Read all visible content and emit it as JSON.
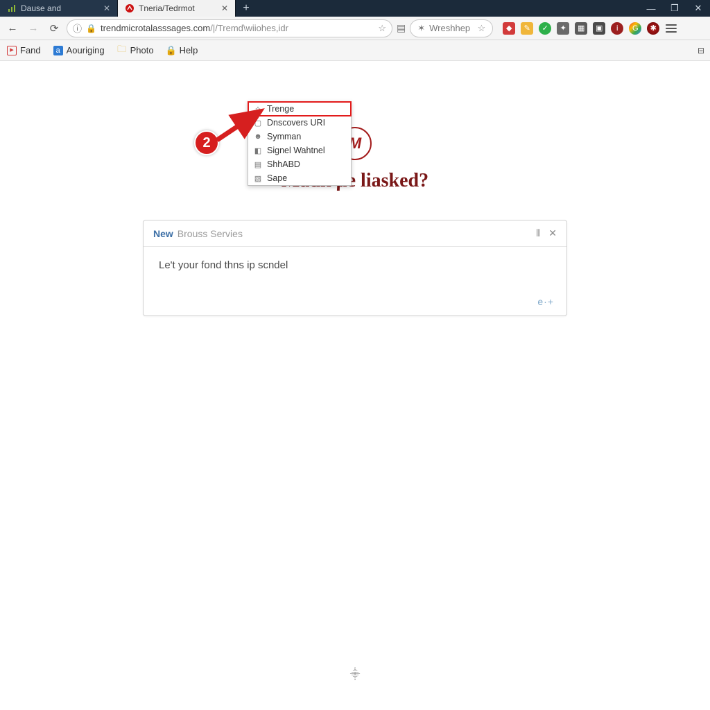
{
  "titlebar": {
    "tabs": [
      {
        "label": "Dause and",
        "active": false
      },
      {
        "label": "Tneria/Tedrmot",
        "active": true
      }
    ]
  },
  "toolbar": {
    "url_host": "trendmicrotalasssages.com",
    "url_path": "/|/Tremd\\wiiohes,idr",
    "search_hint": "Wreshhep"
  },
  "bookmarks": [
    {
      "label": "Fand"
    },
    {
      "label": "Aouriging"
    },
    {
      "label": "Photo"
    },
    {
      "label": "Help"
    }
  ],
  "autocomplete": [
    "Trenge",
    "Dnscovers URI",
    "Symman",
    "Signel Wahtnel",
    "ShhABD",
    "Sape"
  ],
  "page": {
    "headline": "Madk µe liasked?",
    "card_new": "New",
    "card_rest": "Brouss Servies",
    "card_line": "Le't your fond thns ip scndel",
    "card_foot": "e·+"
  },
  "annotation": {
    "badge": "2"
  }
}
